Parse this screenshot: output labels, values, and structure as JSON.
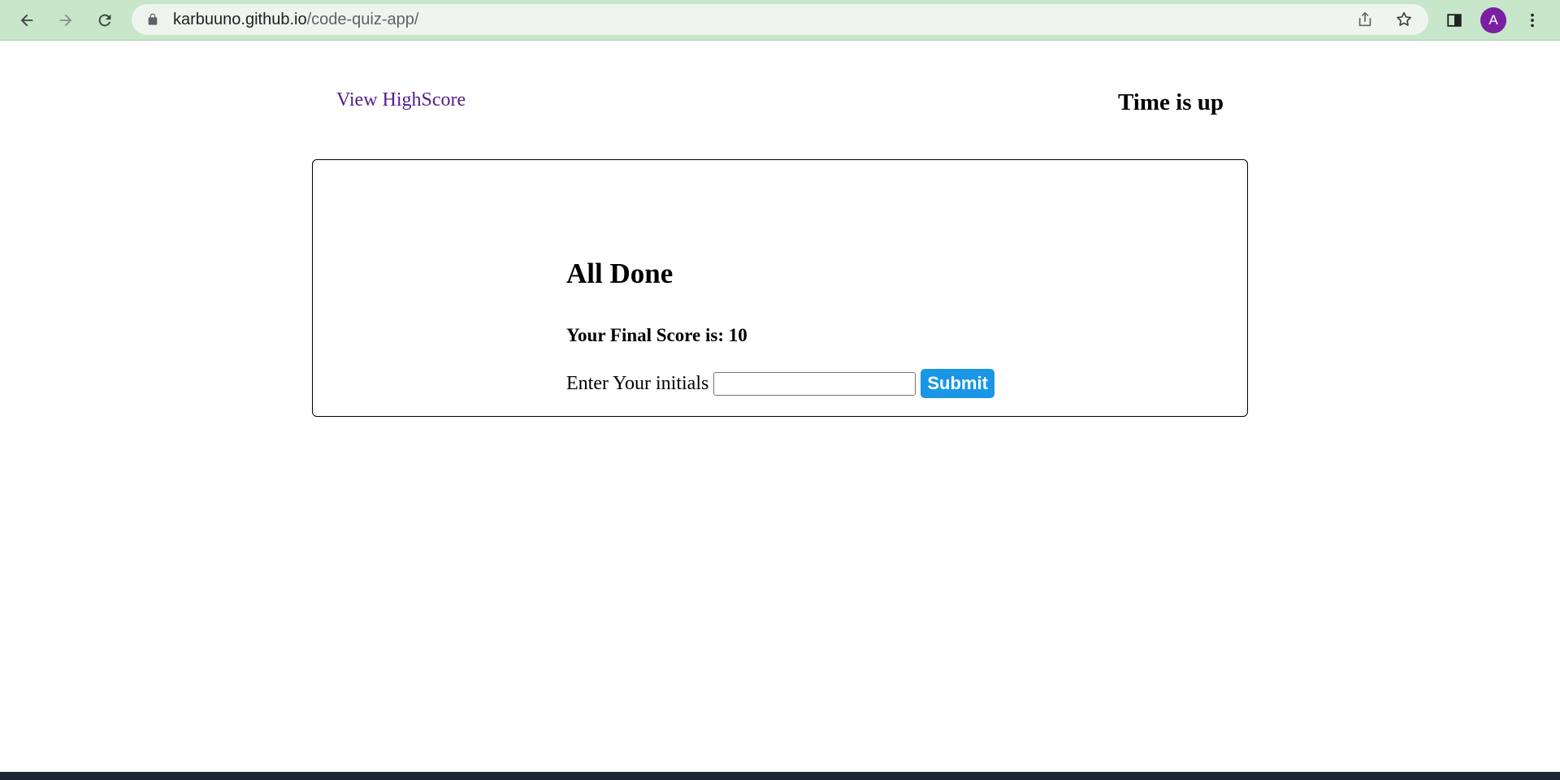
{
  "browser": {
    "url_host": "karbuuno.github.io",
    "url_path": "/code-quiz-app/",
    "profile_initial": "A",
    "icons": {
      "back": "arrow-left-icon",
      "forward": "arrow-right-icon",
      "reload": "reload-icon",
      "lock": "lock-icon",
      "share": "share-icon",
      "bookmark": "star-icon",
      "side_panel": "side-panel-icon",
      "menu": "kebab-menu-icon"
    },
    "colors": {
      "toolbar": "#c8e6c9",
      "omnibox": "#eef5ee",
      "avatar": "#7b1fa2"
    }
  },
  "header": {
    "highscore_link": "View HighScore",
    "timer_text": "Time is up"
  },
  "quiz": {
    "title": "All Done",
    "final_score": "Your Final Score is: 10",
    "initials_label": "Enter Your initials",
    "initials_value": "",
    "submit_label": "Submit",
    "colors": {
      "submit_button": "#1a96e6",
      "link": "#551a8b"
    }
  }
}
